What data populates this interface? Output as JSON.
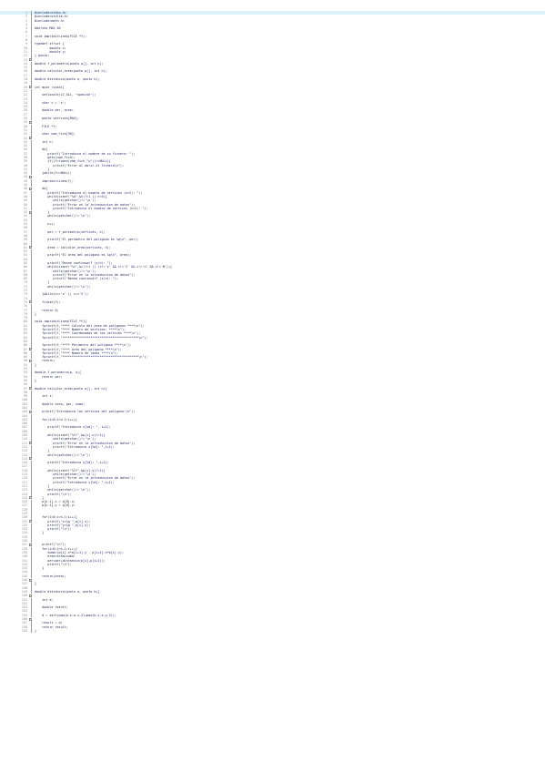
{
  "editor": {
    "highlight_line": 1,
    "folds": [
      13,
      20,
      29,
      33,
      43,
      46,
      52,
      61,
      75,
      87,
      90,
      97,
      103,
      111,
      115,
      125,
      131,
      137,
      146,
      150,
      156
    ],
    "lines": [
      "#include<stdio.h>",
      "#include<stdlib.h>",
      "#include<math.h>",
      "",
      "#define MAX 50",
      "",
      "void imprimirLinea(FILE *f);",
      "",
      "typedef struct {",
      "        double x;",
      "        double y;",
      "} punto;",
      "",
      "double f_perimetro(punto p[], int n);",
      "",
      "double calcular_area(punto p[], int n);",
      "",
      "double distancia(punto a, punto b);",
      "",
      "int main (void){",
      "",
      "    setlocale(LC_ALL, \"spanish\");",
      "",
      "    char c = 's';",
      "",
      "    double per, area;",
      "",
      "    punto vertices[MAX];",
      "",
      "    FILE *f;",
      "",
      "    char nom_fich[30];",
      "",
      "    int n;",
      "",
      "    do{",
      "       printf(\"Introduzca el nombre de su fichero: \");",
      "       gets(nom_fich);",
      "       if((f=fopen(nom_fich,\"w\"))==NULL){",
      "          printf(\"Error al abrir el fichero\\n\");",
      "       }",
      "    }while(f==NULL);",
      "",
      "    imprimirLinea(f);",
      "",
      "    do{",
      "       printf(\"Introduzca el numero de vertices (n>2): \");",
      "       while(scanf(\"%d\",&n)!=1 || n<3){",
      "          while(getchar()!='\\n');",
      "          printf(\"Error en la introduccion de datos\");",
      "          printf(\"Introduzca el numero de vertices (n>2): \");",
      "       }",
      "       while(getchar()!='\\n');",
      "",
      "       n++;",
      "",
      "       per = f_perimetro(vertices, n);",
      "",
      "       printf(\"El perimetro del poligono es %g\\n\", per);",
      "",
      "       area = calcular_area(vertices, n);",
      "",
      "       printf(\"El area del poligono es %g\\n\", area);",
      "",
      "       printf(\"Desea continuar? (s/n): \");",
      "       while(scanf(\"%c\",&c)!=1 || (c!='s' && c!='S' && c!='n' && c!='N')){",
      "          while(getchar()!='\\n');",
      "          printf(\"Error en la introduccion de datos\");",
      "          printf(\"Desea continuar? (s/n): \");",
      "       }",
      "       while(getchar()!='\\n');",
      "",
      "    }while(c=='s' || c=='S');",
      "",
      "    fclose(f);",
      "",
      "    return 0;",
      "}",
      "",
      "void imprimirLinea(FILE *f){",
      "    fprintf(f,\"**** Calculo del area de poligonos ****\\n\");",
      "    fprintf(f,\"**** Numero de vertices: ****\\n\");",
      "    fprintf(f,\"**** Coordenadas de los vertices ****\\n\");",
      "    fprintf(f,\"*****************************************\\n\");",
      "",
      "    fprintf(f,\"**** Perimetro del poligono ****\\n\");",
      "    fprintf(f,\"**** Area del poligono ****\\n\");",
      "    fprintf(f,\"**** Numero de lados ****\\n\");",
      "    fprintf(f,\"*****************************************\\n\");",
      "    return;",
      "}",
      "",
      "double f_perimetro(p, n){",
      "    return per;",
      "}",
      "",
      "double calcular_area(punto p[], int n){",
      "",
      "    int i;",
      "",
      "    double area, per, suma;",
      "",
      "    printf(\"Introduzca los vertices del poligono:\\n\");",
      "",
      "    for(i=0;i<n-1;i++){",
      "",
      "       printf(\"Introduzca x[%d]: \", i+1);",
      "",
      "       while(scanf(\"%lf\",&p[i].x)!=1){",
      "          while(getchar()!='\\n');",
      "          printf(\"Error en la introduccion de datos\");",
      "          printf(\"Introduzca x[%d]: \",i+1);",
      "       }",
      "       while(getchar()!='\\n');",
      "",
      "       printf(\"Introduzca y[%d]: \",i+1);",
      "",
      "       while(scanf(\"%lf\",&p[i].y)!=1){",
      "          while(getchar()!='\\n');",
      "          printf(\"Error en la introduccion de datos\");",
      "          printf(\"Introduzca y[%d]: \",i+1);",
      "       }",
      "       while(getchar()!='\\n');",
      "       printf(\"\\n\");",
      "    }",
      "    p[n-1].x = p[0].x;",
      "    p[n-1].y = p[0].y;",
      "",
      "",
      "    for(i=0;i<n-1;i++){",
      "       printf(\"x=%g \",p[i].x);",
      "       printf(\"y=%g \",p[i].y);",
      "       printf(\"\\n\");",
      "    }",
      "",
      "",
      "    printf(\"\\n\");",
      "    for(i=0;i<n-1;i++){",
      "       suma=(p[i].x*p[i+1].y - p[i+1].x*p[i].y);",
      "       area=area+suma;",
      "       per=per+distancia(p[i],p[i+1]);",
      "       printf(\"\\n\");",
      "    }",
      "",
      "    return(area);",
      "",
      "}",
      "",
      "double distancia(punto a, punto b){",
      "",
      "    int d;",
      "",
      "    double result;",
      "",
      "    d = sqrt(pow(b.x-a.x,2)+pow(b.y-a.y,2));",
      "",
      "    result = d;",
      "    return result;",
      "}"
    ]
  }
}
